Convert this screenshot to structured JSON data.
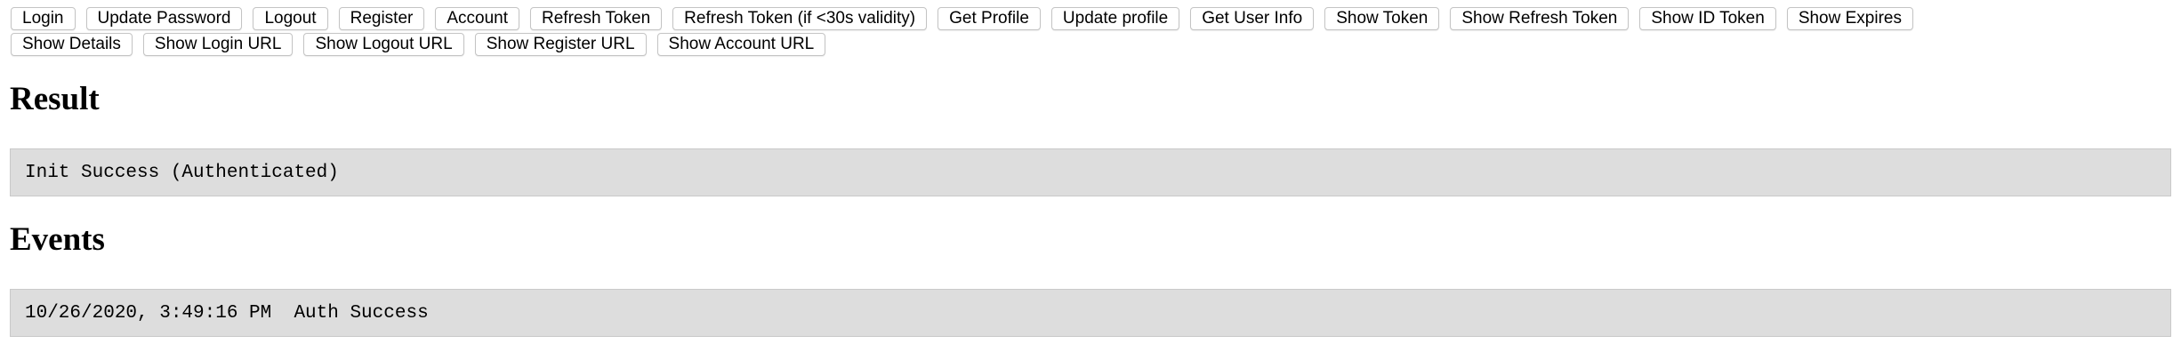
{
  "toolbar": {
    "row1": [
      {
        "name": "login-button",
        "label": "Login"
      },
      {
        "name": "update-password-button",
        "label": "Update Password"
      },
      {
        "name": "logout-button",
        "label": "Logout"
      },
      {
        "name": "register-button",
        "label": "Register"
      },
      {
        "name": "account-button",
        "label": "Account"
      },
      {
        "name": "refresh-token-button",
        "label": "Refresh Token"
      },
      {
        "name": "refresh-token-if-needed-button",
        "label": "Refresh Token (if <30s validity)"
      },
      {
        "name": "get-profile-button",
        "label": "Get Profile"
      },
      {
        "name": "update-profile-button",
        "label": "Update profile"
      },
      {
        "name": "get-user-info-button",
        "label": "Get User Info"
      },
      {
        "name": "show-token-button",
        "label": "Show Token"
      },
      {
        "name": "show-refresh-token-button",
        "label": "Show Refresh Token"
      },
      {
        "name": "show-id-token-button",
        "label": "Show ID Token"
      },
      {
        "name": "show-expires-button",
        "label": "Show Expires"
      }
    ],
    "row2": [
      {
        "name": "show-details-button",
        "label": "Show Details"
      },
      {
        "name": "show-login-url-button",
        "label": "Show Login URL"
      },
      {
        "name": "show-logout-url-button",
        "label": "Show Logout URL"
      },
      {
        "name": "show-register-url-button",
        "label": "Show Register URL"
      },
      {
        "name": "show-account-url-button",
        "label": "Show Account URL"
      }
    ]
  },
  "result": {
    "heading": "Result",
    "output": "Init Success (Authenticated)"
  },
  "events": {
    "heading": "Events",
    "output": "10/26/2020, 3:49:16 PM  Auth Success"
  }
}
